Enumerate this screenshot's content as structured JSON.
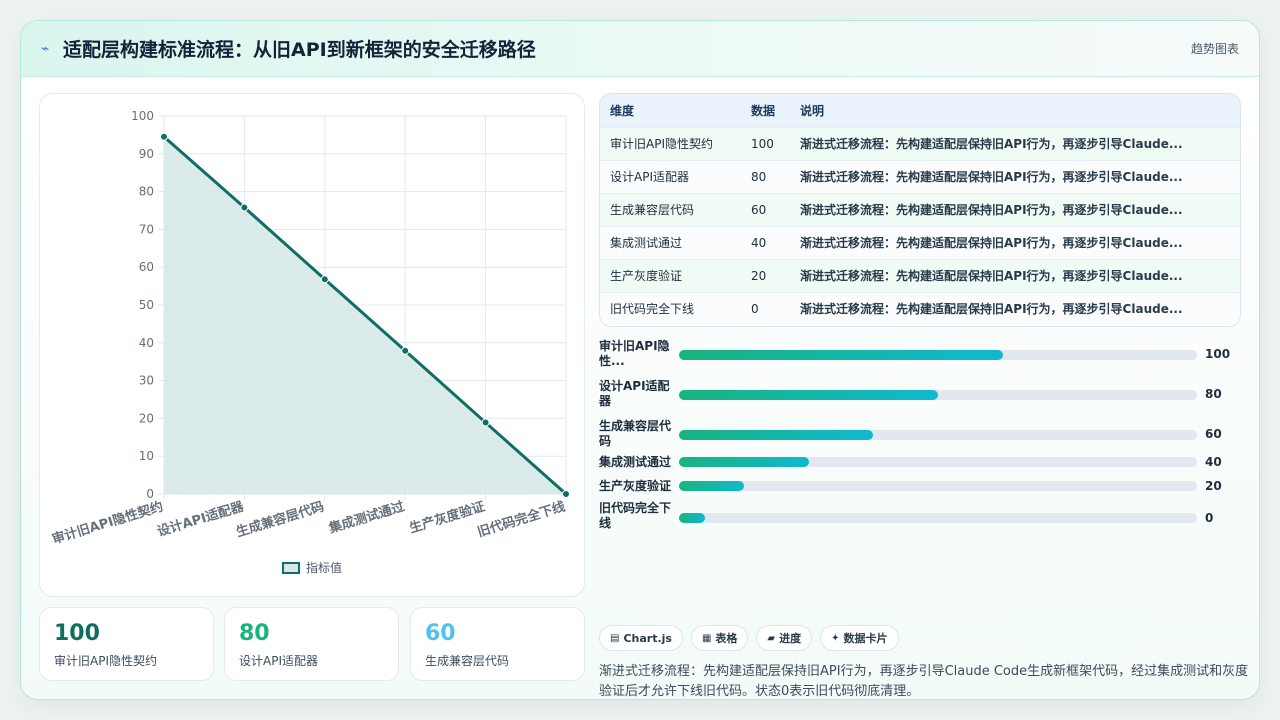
{
  "header": {
    "title": "适配层构建标准流程：从旧API到新框架的安全迁移路径",
    "title_icon": "⌁",
    "right_tag": "趋势图表"
  },
  "chart_data": {
    "type": "area",
    "categories": [
      "审计旧API隐性契约",
      "设计API适配器",
      "生成兼容层代码",
      "集成测试通过",
      "生产灰度验证",
      "旧代码完全下线"
    ],
    "series": [
      {
        "name": "指标值",
        "values": [
          94.5,
          75.8,
          56.8,
          37.9,
          18.9,
          0
        ]
      }
    ],
    "ylim": [
      0,
      100
    ],
    "yticks": [
      0,
      10,
      20,
      30,
      40,
      50,
      60,
      70,
      80,
      90,
      100
    ],
    "grid": true,
    "legend": "bottom",
    "line_color": "#0f6e66",
    "fill_color": "#d5e8e5"
  },
  "stats": [
    {
      "value": "100",
      "label": "审计旧API隐性契约",
      "color": "#0f6e5e"
    },
    {
      "value": "80",
      "label": "设计API适配器",
      "color": "#19b47e"
    },
    {
      "value": "60",
      "label": "生成兼容层代码",
      "color": "#4fc3f0"
    }
  ],
  "table": {
    "headers": [
      "维度",
      "数据",
      "说明"
    ],
    "rows": [
      {
        "dim": "审计旧API隐性契约",
        "val": "100",
        "desc": "渐进式迁移流程：先构建适配层保持旧API行为，再逐步引导Claude..."
      },
      {
        "dim": "设计API适配器",
        "val": "80",
        "desc": "渐进式迁移流程：先构建适配层保持旧API行为，再逐步引导Claude..."
      },
      {
        "dim": "生成兼容层代码",
        "val": "60",
        "desc": "渐进式迁移流程：先构建适配层保持旧API行为，再逐步引导Claude..."
      },
      {
        "dim": "集成测试通过",
        "val": "40",
        "desc": "渐进式迁移流程：先构建适配层保持旧API行为，再逐步引导Claude..."
      },
      {
        "dim": "生产灰度验证",
        "val": "20",
        "desc": "渐进式迁移流程：先构建适配层保持旧API行为，再逐步引导Claude..."
      },
      {
        "dim": "旧代码完全下线",
        "val": "0",
        "desc": "渐进式迁移流程：先构建适配层保持旧API行为，再逐步引导Claude..."
      }
    ]
  },
  "bars": [
    {
      "label": "审计旧API隐性...",
      "value": "100",
      "fraction": 0.625
    },
    {
      "label": "设计API适配器",
      "value": "80",
      "fraction": 0.5
    },
    {
      "label": "生成兼容层代码",
      "value": "60",
      "fraction": 0.375
    },
    {
      "label": "集成测试通过",
      "value": "40",
      "fraction": 0.25
    },
    {
      "label": "生产灰度验证",
      "value": "20",
      "fraction": 0.125
    },
    {
      "label": "旧代码完全下线",
      "value": "0",
      "fraction": 0.05
    }
  ],
  "chips": [
    {
      "icon": "▤",
      "label": "Chart.js"
    },
    {
      "icon": "▦",
      "label": "表格"
    },
    {
      "icon": "▰",
      "label": "进度"
    },
    {
      "icon": "✦",
      "label": "数据卡片"
    }
  ],
  "note": "渐进式迁移流程：先构建适配层保持旧API行为，再逐步引导Claude Code生成新框架代码，经过集成测试和灰度验证后才允许下线旧代码。状态0表示旧代码彻底清理。"
}
